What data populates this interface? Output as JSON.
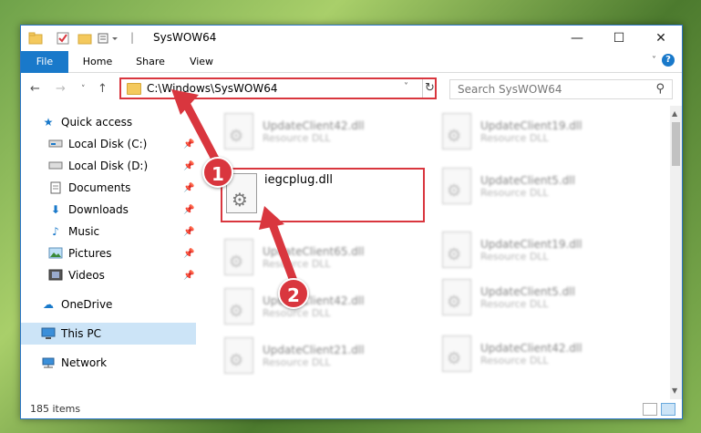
{
  "window": {
    "title": "SysWOW64",
    "controls": {
      "minimize": "—",
      "maximize": "☐",
      "close": "✕"
    }
  },
  "ribbon": {
    "tabs": [
      {
        "label": "File"
      },
      {
        "label": "Home"
      },
      {
        "label": "Share"
      },
      {
        "label": "View"
      }
    ],
    "help": "?"
  },
  "address": {
    "path": "C:\\Windows\\SysWOW64",
    "search_placeholder": "Search SysWOW64"
  },
  "sidebar": {
    "items": [
      {
        "label": "Quick access",
        "icon": "star-icon",
        "pinned": false
      },
      {
        "label": "Local Disk (C:)",
        "icon": "drive-icon",
        "pinned": true
      },
      {
        "label": "Local Disk (D:)",
        "icon": "drive-icon",
        "pinned": true
      },
      {
        "label": "Documents",
        "icon": "documents-icon",
        "pinned": true
      },
      {
        "label": "Downloads",
        "icon": "download-icon",
        "pinned": true
      },
      {
        "label": "Music",
        "icon": "music-icon",
        "pinned": true
      },
      {
        "label": "Pictures",
        "icon": "pictures-icon",
        "pinned": true
      },
      {
        "label": "Videos",
        "icon": "videos-icon",
        "pinned": true
      },
      {
        "label": "OneDrive",
        "icon": "cloud-icon",
        "pinned": false
      },
      {
        "label": "This PC",
        "icon": "computer-icon",
        "pinned": false,
        "selected": true
      },
      {
        "label": "Network",
        "icon": "network-icon",
        "pinned": false
      }
    ]
  },
  "files": {
    "highlighted": {
      "name": "iegcplug.dll"
    },
    "column1": [
      {
        "name": "UpdateClient42.dll",
        "type": "Resource DLL"
      },
      {
        "name": "UpdateClient65.dll",
        "type": "Resource DLL"
      },
      {
        "name": "UpdateClient42.dll",
        "type": "Resource DLL"
      },
      {
        "name": "UpdateClient21.dll",
        "type": "Resource DLL"
      }
    ],
    "column2": [
      {
        "name": "UpdateClient19.dll",
        "type": "Resource DLL"
      },
      {
        "name": "UpdateClient5.dll",
        "type": "Resource DLL"
      },
      {
        "name": "UpdateClient19.dll",
        "type": "Resource DLL"
      },
      {
        "name": "UpdateClient5.dll",
        "type": "Resource DLL"
      },
      {
        "name": "UpdateClient42.dll",
        "type": "Resource DLL"
      }
    ]
  },
  "status": {
    "items_count": "185 items"
  },
  "annotations": {
    "step1": "1",
    "step2": "2",
    "color": "#d9363e"
  }
}
